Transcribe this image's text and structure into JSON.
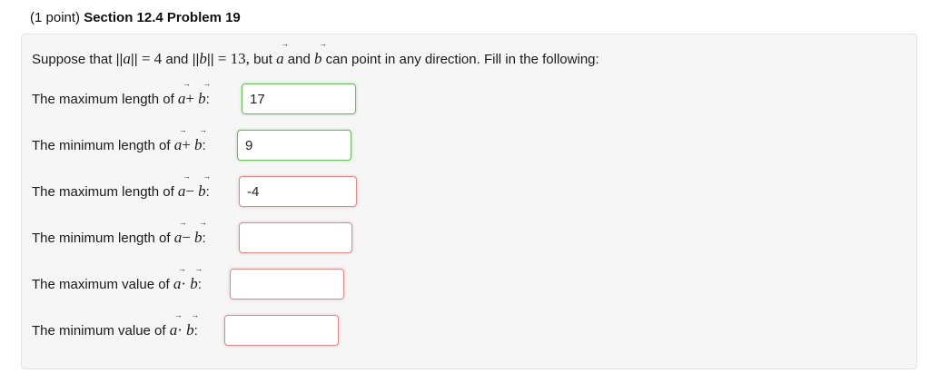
{
  "header": {
    "points": "(1 point)",
    "title": "Section 12.4 Problem 19"
  },
  "intro": {
    "prefix": "Suppose that",
    "norm_a": "||a||",
    "eq1": "= 4",
    "and": "and",
    "norm_b": "||b||",
    "eq2": "= 13,",
    "but": "but",
    "vec_a": "a",
    "and2": "and",
    "vec_b": "b",
    "suffix": "can point in any direction. Fill in the following:"
  },
  "questions": [
    {
      "text": "The maximum length of",
      "op": "+",
      "value": "17",
      "state": "correct"
    },
    {
      "text": "The minimum length of",
      "op": "+",
      "value": "9",
      "state": "correct"
    },
    {
      "text": "The maximum length of",
      "op": "−",
      "value": "-4",
      "state": "incorrect"
    },
    {
      "text": "The minimum length of",
      "op": "−",
      "value": "",
      "state": "incorrect"
    },
    {
      "text": "The maximum value of",
      "op": "·",
      "value": "",
      "state": "incorrect"
    },
    {
      "text": "The minimum value of",
      "op": "·",
      "value": "",
      "state": "incorrect"
    }
  ],
  "colors": {
    "correct_border": "#6cba5f",
    "incorrect_border": "#dc8a8a",
    "panel_bg": "#f6f6f6"
  }
}
